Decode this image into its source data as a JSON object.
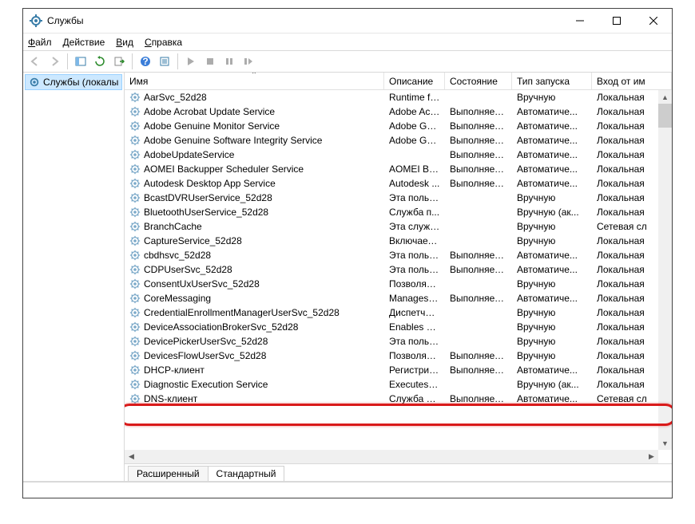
{
  "window": {
    "title": "Службы"
  },
  "menu": {
    "file": "Файл",
    "action": "Действие",
    "view": "Вид",
    "help": "Справка"
  },
  "tree": {
    "root": "Службы (локалы"
  },
  "columns": {
    "name": "Имя",
    "desc": "Описание",
    "state": "Состояние",
    "startup": "Тип запуска",
    "logon": "Вход от им"
  },
  "tabs": {
    "extended": "Расширенный",
    "standard": "Стандартный"
  },
  "rows": [
    {
      "name": "AarSvc_52d28",
      "desc": "Runtime fo...",
      "state": "",
      "startup": "Вручную",
      "logon": "Локальная"
    },
    {
      "name": "Adobe Acrobat Update Service",
      "desc": "Adobe Acr...",
      "state": "Выполняется",
      "startup": "Автоматиче...",
      "logon": "Локальная"
    },
    {
      "name": "Adobe Genuine Monitor Service",
      "desc": "Adobe Gen...",
      "state": "Выполняется",
      "startup": "Автоматиче...",
      "logon": "Локальная"
    },
    {
      "name": "Adobe Genuine Software Integrity Service",
      "desc": "Adobe Gen...",
      "state": "Выполняется",
      "startup": "Автоматиче...",
      "logon": "Локальная"
    },
    {
      "name": "AdobeUpdateService",
      "desc": "",
      "state": "Выполняется",
      "startup": "Автоматиче...",
      "logon": "Локальная"
    },
    {
      "name": "AOMEI Backupper Scheduler Service",
      "desc": "AOMEI Bac...",
      "state": "Выполняется",
      "startup": "Автоматиче...",
      "logon": "Локальная"
    },
    {
      "name": "Autodesk Desktop App Service",
      "desc": "Autodesk ...",
      "state": "Выполняется",
      "startup": "Автоматиче...",
      "logon": "Локальная"
    },
    {
      "name": "BcastDVRUserService_52d28",
      "desc": "Эта польз...",
      "state": "",
      "startup": "Вручную",
      "logon": "Локальная"
    },
    {
      "name": "BluetoothUserService_52d28",
      "desc": "Служба п...",
      "state": "",
      "startup": "Вручную (ак...",
      "logon": "Локальная"
    },
    {
      "name": "BranchCache",
      "desc": "Эта служб...",
      "state": "",
      "startup": "Вручную",
      "logon": "Сетевая сл"
    },
    {
      "name": "CaptureService_52d28",
      "desc": "Включает ...",
      "state": "",
      "startup": "Вручную",
      "logon": "Локальная"
    },
    {
      "name": "cbdhsvc_52d28",
      "desc": "Эта польз...",
      "state": "Выполняется",
      "startup": "Автоматиче...",
      "logon": "Локальная"
    },
    {
      "name": "CDPUserSvc_52d28",
      "desc": "Эта польз...",
      "state": "Выполняется",
      "startup": "Автоматиче...",
      "logon": "Локальная"
    },
    {
      "name": "ConsentUxUserSvc_52d28",
      "desc": "Позволяет...",
      "state": "",
      "startup": "Вручную",
      "logon": "Локальная"
    },
    {
      "name": "CoreMessaging",
      "desc": "Manages c...",
      "state": "Выполняется",
      "startup": "Автоматиче...",
      "logon": "Локальная"
    },
    {
      "name": "CredentialEnrollmentManagerUserSvc_52d28",
      "desc": "Диспетчер...",
      "state": "",
      "startup": "Вручную",
      "logon": "Локальная"
    },
    {
      "name": "DeviceAssociationBrokerSvc_52d28",
      "desc": "Enables ap...",
      "state": "",
      "startup": "Вручную",
      "logon": "Локальная"
    },
    {
      "name": "DevicePickerUserSvc_52d28",
      "desc": "Эта польз...",
      "state": "",
      "startup": "Вручную",
      "logon": "Локальная"
    },
    {
      "name": "DevicesFlowUserSvc_52d28",
      "desc": "Позволяет...",
      "state": "Выполняется",
      "startup": "Вручную",
      "logon": "Локальная"
    },
    {
      "name": "DHCP-клиент",
      "desc": "Регистрир...",
      "state": "Выполняется",
      "startup": "Автоматиче...",
      "logon": "Локальная"
    },
    {
      "name": "Diagnostic Execution Service",
      "desc": "Executes di...",
      "state": "",
      "startup": "Вручную (ак...",
      "logon": "Локальная"
    },
    {
      "name": "DNS-клиент",
      "desc": "Служба D...",
      "state": "Выполняется",
      "startup": "Автоматиче...",
      "logon": "Сетевая сл"
    }
  ],
  "highlight_index": 21
}
